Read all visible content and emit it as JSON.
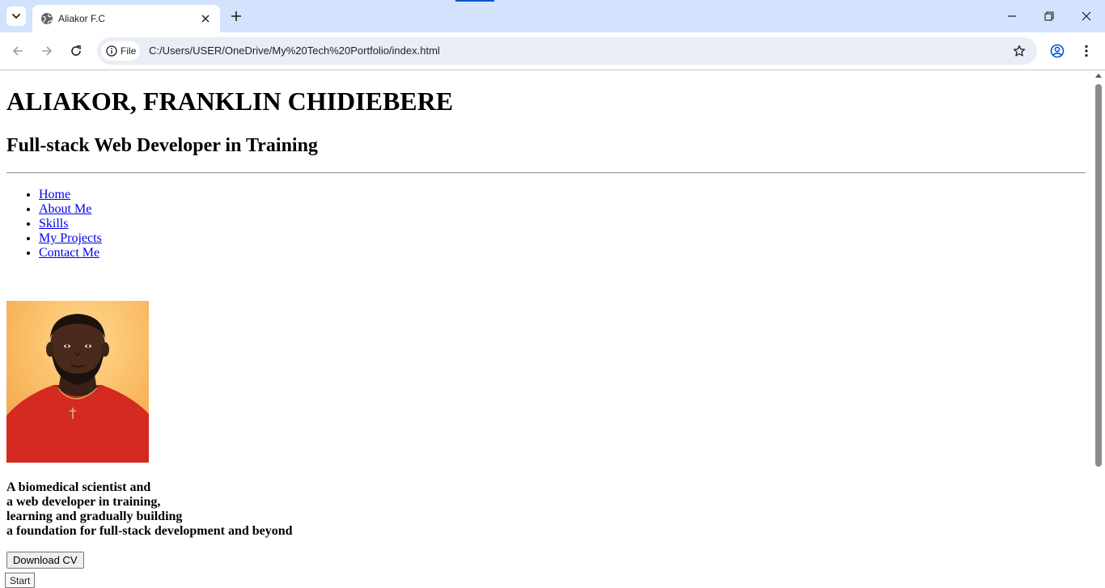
{
  "browser": {
    "tab_title": "Aliakor F.C",
    "file_chip_label": "File",
    "url": "C:/Users/USER/OneDrive/My%20Tech%20Portfolio/index.html",
    "icons": {
      "tab_list": "chevron-down-icon",
      "favicon": "globe-icon",
      "tab_close": "close-icon",
      "new_tab": "plus-icon",
      "minimize": "minimize-icon",
      "restore": "restore-icon",
      "close_window": "close-icon",
      "back": "arrow-left-icon",
      "forward": "arrow-right-icon",
      "reload": "reload-icon",
      "site_info": "info-icon",
      "bookmark": "star-icon",
      "profile": "profile-icon",
      "menu": "kebab-menu-icon"
    },
    "colors": {
      "tabstrip": "#d3e3fd",
      "omnibox": "#e9eef6",
      "accent": "#0b57d0"
    }
  },
  "page": {
    "title": "ALIAKOR, FRANKLIN CHIDIEBERE",
    "subtitle": "Full-stack Web Developer in Training",
    "nav": [
      "Home",
      "About Me",
      "Skills",
      "My Projects",
      "Contact Me"
    ],
    "bio_lines": [
      "A biomedical scientist and",
      "a web developer in training,",
      "learning and gradually building",
      "a foundation for full-stack development and beyond"
    ],
    "download_label": "Download CV",
    "tooltip": "Start",
    "colors": {
      "link": "#0000ee",
      "photo_background": "#f9b860",
      "shirt": "#d42a22"
    }
  }
}
